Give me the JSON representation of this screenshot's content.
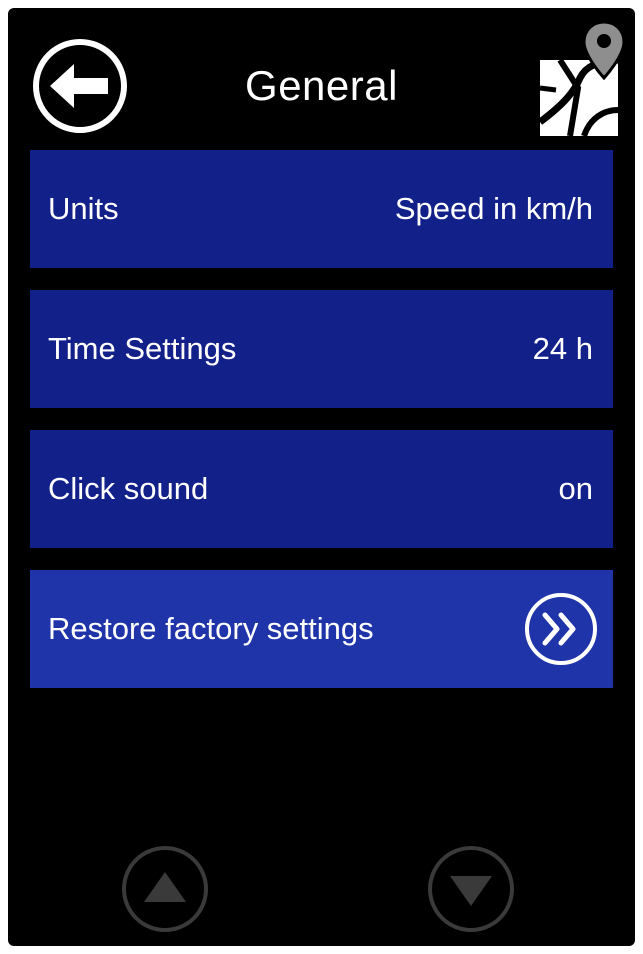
{
  "header": {
    "title": "General",
    "back_icon": "back-arrow-icon",
    "map_icon": "map-pin-icon"
  },
  "menu": {
    "items": [
      {
        "label": "Units",
        "value": "Speed in km/h"
      },
      {
        "label": "Time Settings",
        "value": "24 h"
      },
      {
        "label": "Click sound",
        "value": "on"
      },
      {
        "label": "Restore factory settings",
        "icon": "double-chevron-right-icon"
      }
    ]
  },
  "footer": {
    "up_icon": "scroll-up-icon",
    "down_icon": "scroll-down-icon"
  },
  "colors": {
    "background": "#000000",
    "row": "#12208a",
    "row_highlight": "#1f34a8",
    "text": "#ffffff",
    "disabled": "#3a3a3a"
  }
}
